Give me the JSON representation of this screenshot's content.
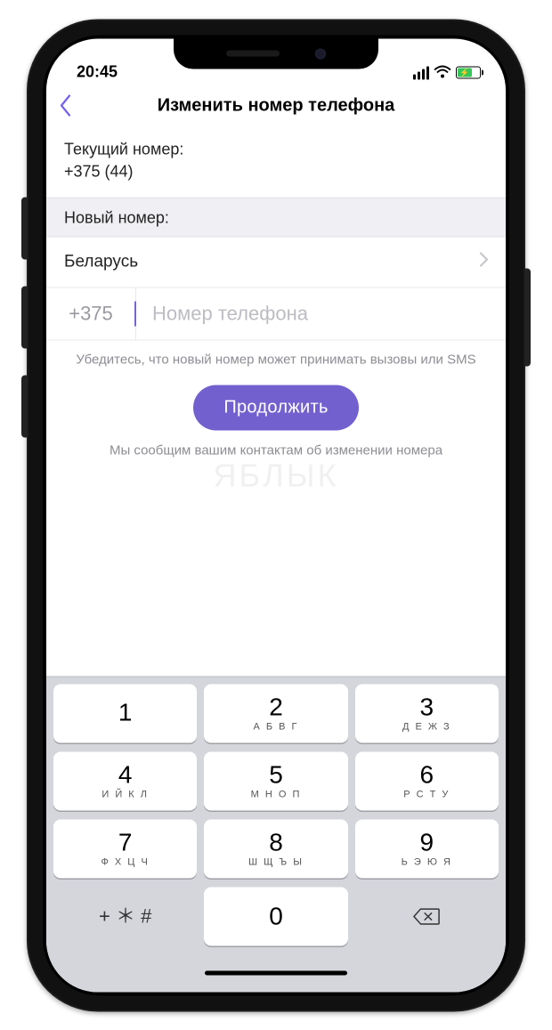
{
  "status": {
    "time": "20:45"
  },
  "nav": {
    "title": "Изменить номер телефона"
  },
  "current": {
    "label": "Текущий номер:",
    "value": "+375 (44)"
  },
  "newSection": {
    "header": "Новый номер:"
  },
  "country": {
    "name": "Беларусь"
  },
  "phone": {
    "prefix": "+375",
    "placeholder": "Номер телефона",
    "value": ""
  },
  "hint": "Убедитесь, что новый номер может принимать вызовы или SMS",
  "cta": "Продолжить",
  "note": "Мы сообщим вашим контактам об изменении номера",
  "watermark": "ЯБЛЫК",
  "keyboard": {
    "rows": [
      [
        {
          "num": "1",
          "sub": ""
        },
        {
          "num": "2",
          "sub": "А Б В Г"
        },
        {
          "num": "3",
          "sub": "Д Е Ж З"
        }
      ],
      [
        {
          "num": "4",
          "sub": "И Й К Л"
        },
        {
          "num": "5",
          "sub": "М Н О П"
        },
        {
          "num": "6",
          "sub": "Р С Т У"
        }
      ],
      [
        {
          "num": "7",
          "sub": "Ф Х Ц Ч"
        },
        {
          "num": "8",
          "sub": "Ш Щ Ъ Ы"
        },
        {
          "num": "9",
          "sub": "Ь Э Ю Я"
        }
      ]
    ],
    "sym": "+ ＊ #",
    "zero": "0"
  }
}
